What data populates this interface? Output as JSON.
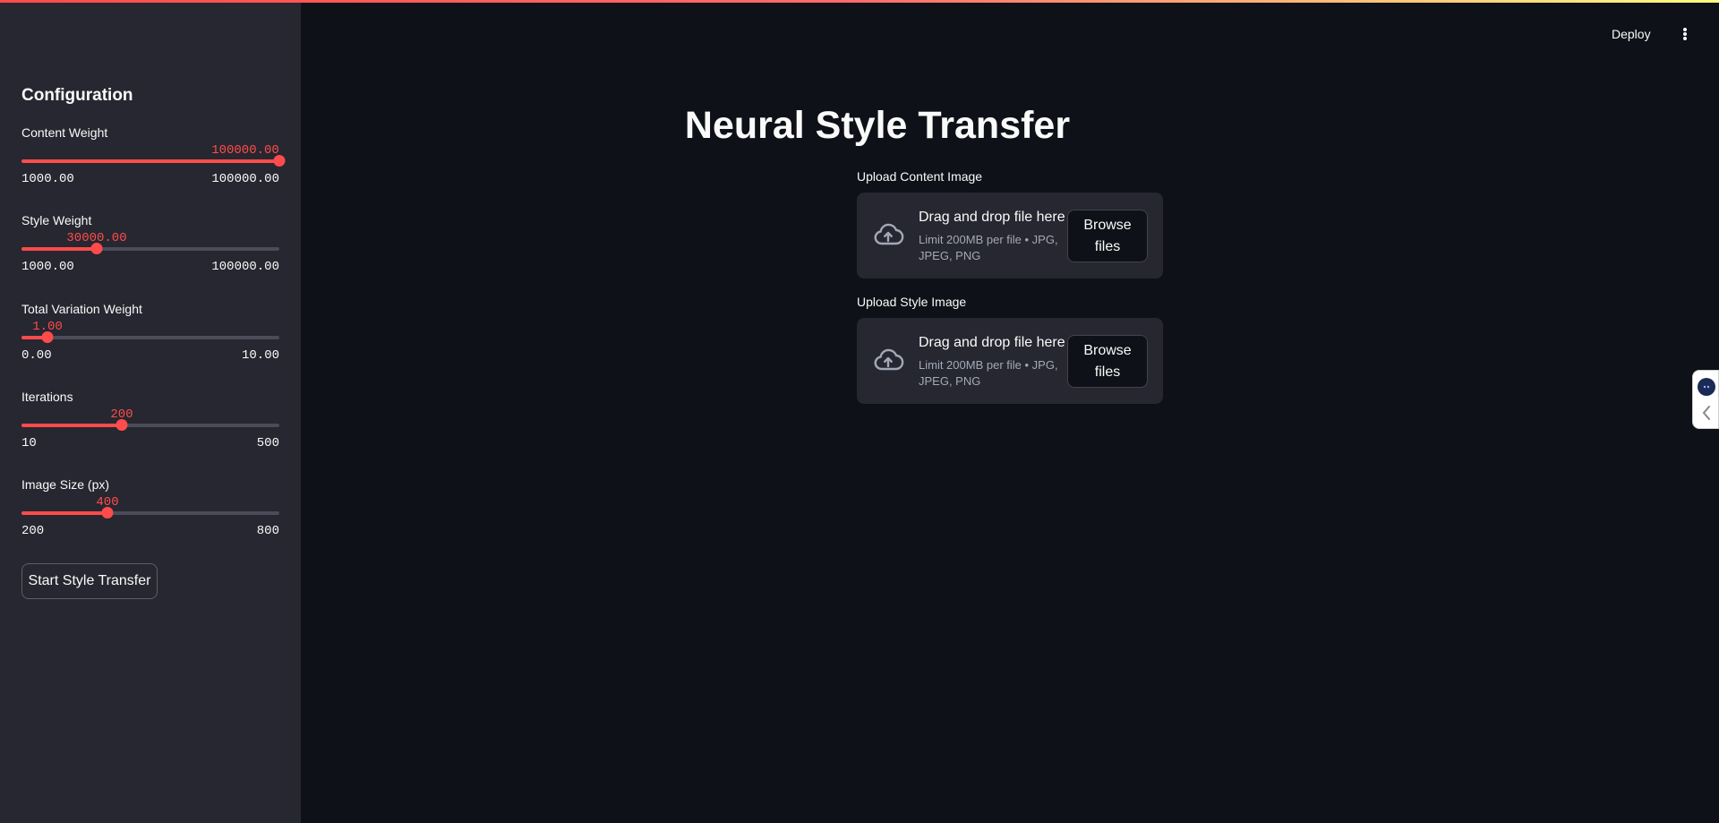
{
  "sidebar": {
    "title": "Configuration",
    "sliders": [
      {
        "label": "Content Weight",
        "value": "100000.00",
        "min": "1000.00",
        "max": "100000.00",
        "fraction": 1.0
      },
      {
        "label": "Style Weight",
        "value": "30000.00",
        "min": "1000.00",
        "max": "100000.00",
        "fraction": 0.293
      },
      {
        "label": "Total Variation Weight",
        "value": "1.00",
        "min": "0.00",
        "max": "10.00",
        "fraction": 0.1
      },
      {
        "label": "Iterations",
        "value": "200",
        "min": "10",
        "max": "500",
        "fraction": 0.388
      },
      {
        "label": "Image Size (px)",
        "value": "400",
        "min": "200",
        "max": "800",
        "fraction": 0.333
      }
    ],
    "start_button": "Start Style Transfer"
  },
  "header": {
    "deploy_label": "Deploy",
    "menu_icon": "vertical-ellipsis-icon"
  },
  "main": {
    "title": "Neural Style Transfer",
    "uploaders": [
      {
        "label": "Upload Content Image",
        "drop_title": "Drag and drop file here",
        "limit": "Limit 200MB per file • JPG, JPEG, PNG",
        "browse": "Browse files"
      },
      {
        "label": "Upload Style Image",
        "drop_title": "Drag and drop file here",
        "limit": "Limit 200MB per file • JPG, JPEG, PNG",
        "browse": "Browse files"
      }
    ],
    "upload_icon": "cloud-upload-icon"
  },
  "colors": {
    "accent": "#ff4b4b",
    "background": "#0e1117",
    "sidebar": "#262730"
  }
}
